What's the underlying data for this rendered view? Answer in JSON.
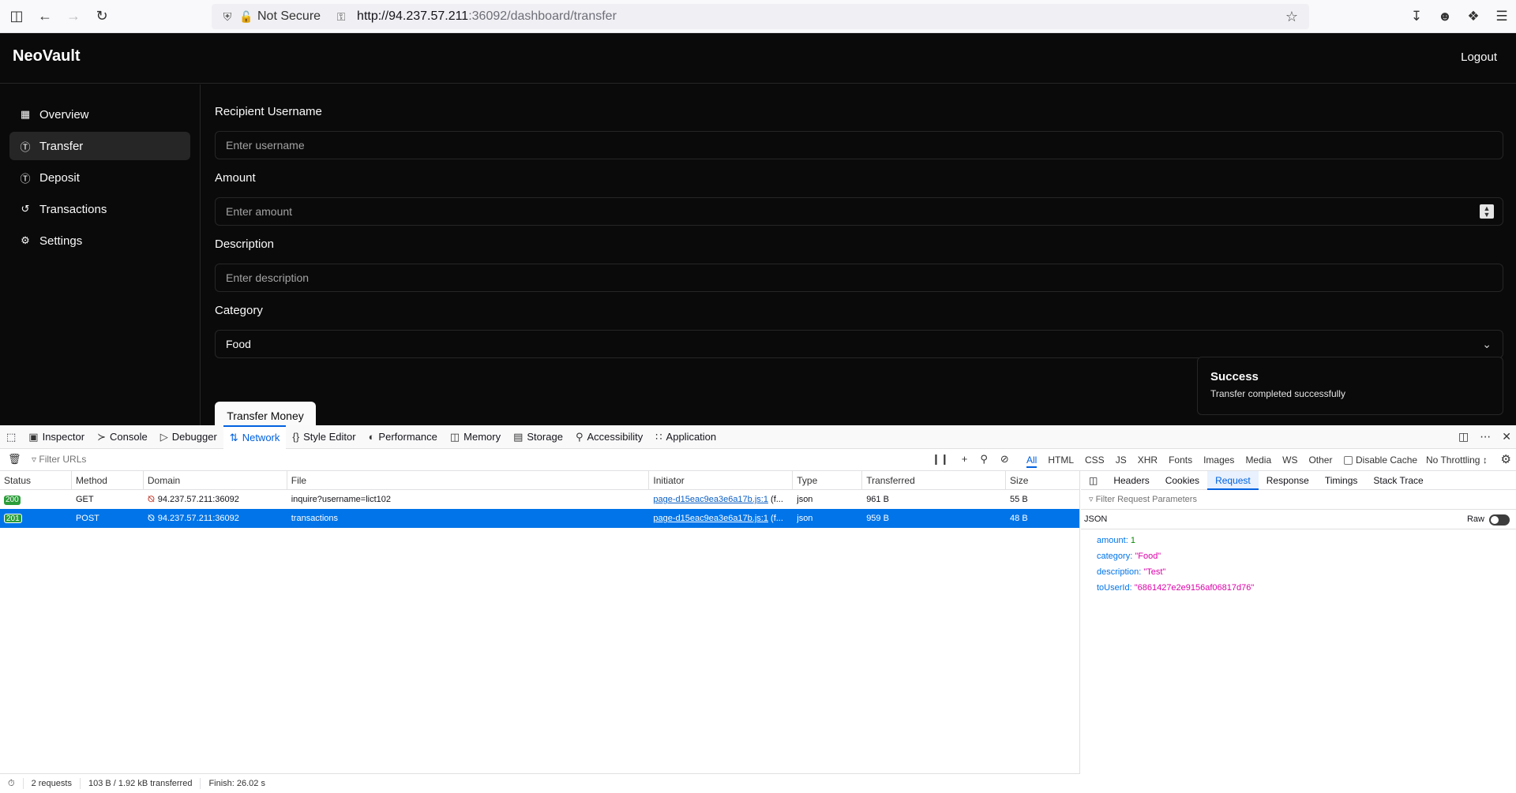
{
  "browser": {
    "not_secure_label": "Not Secure",
    "url_host": "http://94.237.57.211",
    "url_rest": ":36092/dashboard/transfer"
  },
  "app": {
    "brand": "NeoVault",
    "logout_label": "Logout",
    "sidebar": {
      "items": [
        {
          "label": "Overview",
          "icon": "grid-icon"
        },
        {
          "label": "Transfer",
          "icon": "dollar-circle-icon"
        },
        {
          "label": "Deposit",
          "icon": "dollar-circle-icon"
        },
        {
          "label": "Transactions",
          "icon": "history-icon"
        },
        {
          "label": "Settings",
          "icon": "gear-icon"
        }
      ],
      "active_index": 1
    },
    "form": {
      "recipient_label": "Recipient Username",
      "recipient_placeholder": "Enter username",
      "amount_label": "Amount",
      "amount_placeholder": "Enter amount",
      "description_label": "Description",
      "description_placeholder": "Enter description",
      "category_label": "Category",
      "category_value": "Food",
      "submit_label": "Transfer Money"
    },
    "toast": {
      "title": "Success",
      "body": "Transfer completed successfully"
    }
  },
  "devtools": {
    "tabs": [
      {
        "label": "Inspector",
        "icon": "inspector-icon"
      },
      {
        "label": "Console",
        "icon": "console-icon"
      },
      {
        "label": "Debugger",
        "icon": "debugger-icon"
      },
      {
        "label": "Network",
        "icon": "network-icon"
      },
      {
        "label": "Style Editor",
        "icon": "braces-icon"
      },
      {
        "label": "Performance",
        "icon": "gauge-icon"
      },
      {
        "label": "Memory",
        "icon": "memory-icon"
      },
      {
        "label": "Storage",
        "icon": "storage-icon"
      },
      {
        "label": "Accessibility",
        "icon": "accessibility-icon"
      },
      {
        "label": "Application",
        "icon": "grid-icon"
      }
    ],
    "active_tab": "Network",
    "filter_placeholder": "Filter URLs",
    "type_filters": [
      "All",
      "HTML",
      "CSS",
      "JS",
      "XHR",
      "Fonts",
      "Images",
      "Media",
      "WS",
      "Other"
    ],
    "active_type_filter": "All",
    "disable_cache_label": "Disable Cache",
    "throttling_label": "No Throttling ↕",
    "columns": [
      "Status",
      "Method",
      "Domain",
      "File",
      "Initiator",
      "Type",
      "Transferred",
      "Size"
    ],
    "requests": [
      {
        "status": "200",
        "method": "GET",
        "domain": "94.237.57.211:36092",
        "file": "inquire?username=lict102",
        "initiator": "page-d15eac9ea3e6a17b.js:1",
        "initiator_suffix": " (f...",
        "type": "json",
        "transferred": "961 B",
        "size": "55 B"
      },
      {
        "status": "201",
        "method": "POST",
        "domain": "94.237.57.211:36092",
        "file": "transactions",
        "initiator": "page-d15eac9ea3e6a17b.js:1",
        "initiator_suffix": " (f...",
        "type": "json",
        "transferred": "959 B",
        "size": "48 B"
      }
    ],
    "panel_tabs": [
      "Headers",
      "Cookies",
      "Request",
      "Response",
      "Timings",
      "Stack Trace"
    ],
    "active_panel_tab": "Request",
    "panel_filter": "Filter Request Parameters",
    "json_label": "JSON",
    "raw_label": "Raw",
    "json": [
      {
        "key": "amount",
        "value": "1",
        "kind": "num"
      },
      {
        "key": "category",
        "value": "\"Food\"",
        "kind": "str"
      },
      {
        "key": "description",
        "value": "\"Test\"",
        "kind": "str"
      },
      {
        "key": "toUserId",
        "value": "\"6861427e2e9156af06817d76\"",
        "kind": "str"
      }
    ],
    "status_bar": {
      "requests": "2 requests",
      "transferred": "103 B / 1.92 kB transferred",
      "finish": "Finish: 26.02 s"
    }
  }
}
